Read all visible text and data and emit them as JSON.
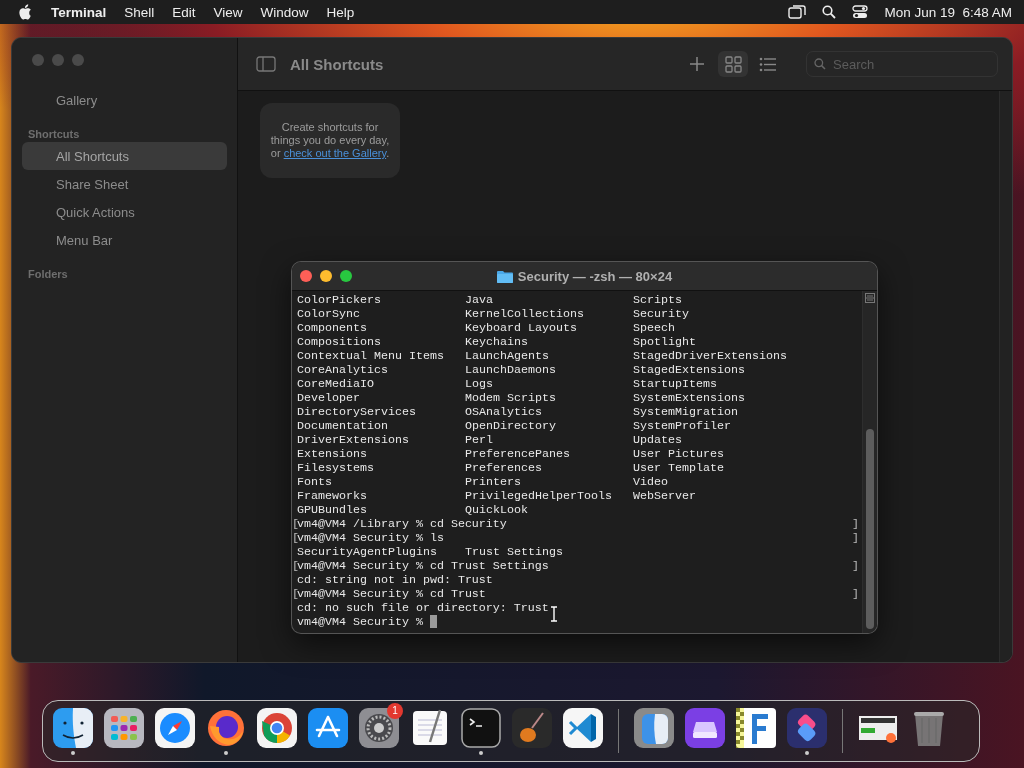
{
  "menu_bar": {
    "app_name": "Terminal",
    "menus": [
      "Shell",
      "Edit",
      "View",
      "Window",
      "Help"
    ],
    "clock": "Mon Jun 19  6:48 AM"
  },
  "shortcuts_window": {
    "title": "All Shortcuts",
    "search": {
      "placeholder": "Search"
    },
    "view_buttons": [
      {
        "kind": "grid",
        "selected": true
      },
      {
        "kind": "list",
        "selected": false
      }
    ],
    "sidebar": {
      "top_items": [
        {
          "label": "Gallery",
          "selected": false
        }
      ],
      "sections": [
        {
          "header": "Shortcuts",
          "items": [
            {
              "label": "All Shortcuts",
              "selected": true
            },
            {
              "label": "Share Sheet",
              "selected": false
            },
            {
              "label": "Quick Actions",
              "selected": false
            },
            {
              "label": "Menu Bar",
              "selected": false
            }
          ]
        },
        {
          "header": "Folders"
        }
      ]
    },
    "empty_card": {
      "text": "Create shortcuts for things you do every day, or",
      "link": "check out the Gallery",
      "after": "."
    }
  },
  "terminal": {
    "title": "Security — -zsh — 80×24",
    "listing": [
      [
        "ColorPickers",
        "Java",
        "Scripts"
      ],
      [
        "ColorSync",
        "KernelCollections",
        "Security"
      ],
      [
        "Components",
        "Keyboard Layouts",
        "Speech"
      ],
      [
        "Compositions",
        "Keychains",
        "Spotlight"
      ],
      [
        "Contextual Menu Items",
        "LaunchAgents",
        "StagedDriverExtensions"
      ],
      [
        "CoreAnalytics",
        "LaunchDaemons",
        "StagedExtensions"
      ],
      [
        "CoreMediaIO",
        "Logs",
        "StartupItems"
      ],
      [
        "Developer",
        "Modem Scripts",
        "SystemExtensions"
      ],
      [
        "DirectoryServices",
        "OSAnalytics",
        "SystemMigration"
      ],
      [
        "Documentation",
        "OpenDirectory",
        "SystemProfiler"
      ],
      [
        "DriverExtensions",
        "Perl",
        "Updates"
      ],
      [
        "Extensions",
        "PreferencePanes",
        "User Pictures"
      ],
      [
        "Filesystems",
        "Preferences",
        "User Template"
      ],
      [
        "Fonts",
        "Printers",
        "Video"
      ],
      [
        "Frameworks",
        "PrivilegedHelperTools",
        "WebServer"
      ],
      [
        "GPUBundles",
        "QuickLook"
      ]
    ],
    "lines": [
      {
        "kind": "prompt",
        "text": "vm4@VM4 /Library % cd Security",
        "marks": [
          "[",
          "]"
        ]
      },
      {
        "kind": "prompt",
        "text": "vm4@VM4 Security % ls",
        "marks": [
          "[",
          "]"
        ]
      },
      {
        "kind": "columns",
        "cells": [
          "SecurityAgentPlugins",
          "Trust Settings"
        ]
      },
      {
        "kind": "prompt",
        "text": "vm4@VM4 Security % cd Trust Settings",
        "marks": [
          "[",
          "]"
        ]
      },
      {
        "kind": "output",
        "text": "cd: string not in pwd: Trust"
      },
      {
        "kind": "prompt",
        "text": "vm4@VM4 Security % cd Trust",
        "marks": [
          "[",
          "]"
        ]
      },
      {
        "kind": "output",
        "text": "cd: no such file or directory: Trust"
      },
      {
        "kind": "input",
        "text": "vm4@VM4 Security % "
      }
    ]
  },
  "dock": {
    "apps": [
      {
        "kind": "finder",
        "running": true
      },
      {
        "kind": "launchpad",
        "running": false
      },
      {
        "kind": "safari",
        "running": false
      },
      {
        "kind": "firefox",
        "running": true
      },
      {
        "kind": "chrome",
        "running": false
      },
      {
        "kind": "appstore",
        "running": false
      },
      {
        "kind": "settings",
        "running": false,
        "badge": "1"
      },
      {
        "kind": "textedit",
        "running": false
      },
      {
        "kind": "terminal",
        "running": true
      },
      {
        "kind": "garageband",
        "running": false
      },
      {
        "kind": "vscode",
        "running": false
      }
    ],
    "recent": [
      {
        "kind": "migration",
        "running": false
      },
      {
        "kind": "drive",
        "running": false
      },
      {
        "kind": "letterf",
        "running": false
      },
      {
        "kind": "shortcuts",
        "running": true
      }
    ],
    "stack": [
      {
        "kind": "thumbnail",
        "running": false
      },
      {
        "kind": "trash",
        "running": false
      }
    ]
  }
}
